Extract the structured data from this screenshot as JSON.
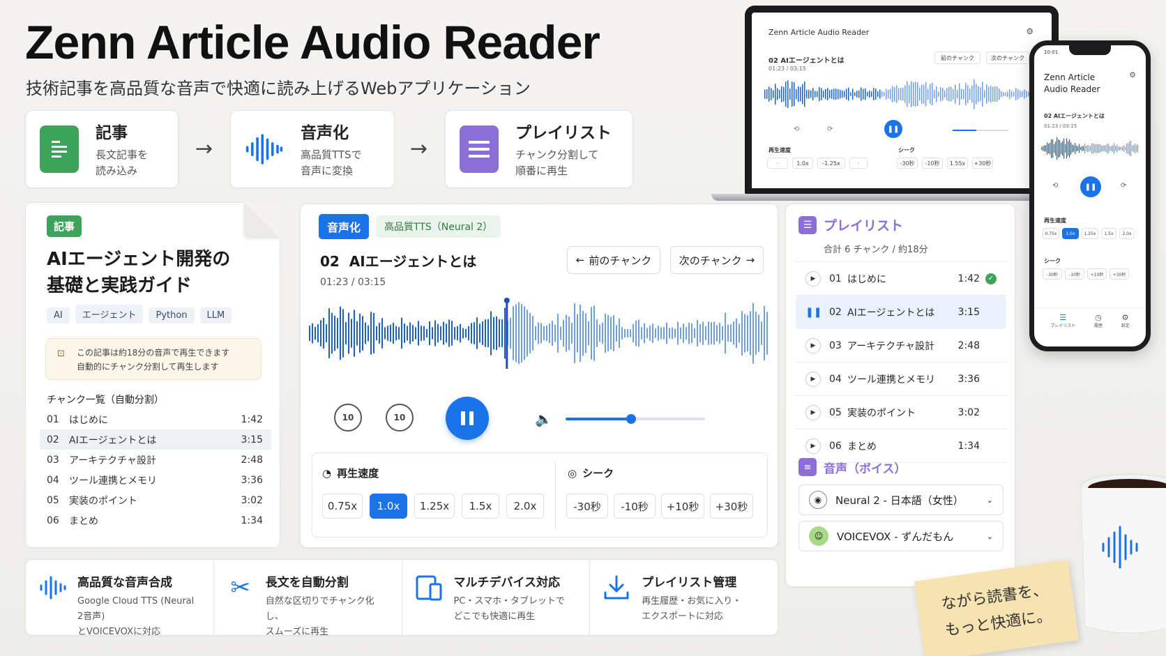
{
  "header": {
    "title": "Zenn Article Audio Reader",
    "subtitle": "技術記事を高品質な音声で快適に読み上げるWebアプリケーション"
  },
  "flow": [
    {
      "title": "記事",
      "desc1": "長文記事を",
      "desc2": "読み込み",
      "icon": "document-icon",
      "color": "#3da35a"
    },
    {
      "title": "音声化",
      "desc1": "高品質TTSで",
      "desc2": "音声に変換",
      "icon": "waveform-icon",
      "color": "#1a73e8"
    },
    {
      "title": "プレイリスト",
      "desc1": "チャンク分割して",
      "desc2": "順番に再生",
      "icon": "list-icon",
      "color": "#8b6fd6"
    }
  ],
  "article": {
    "badge": "記事",
    "title_line1": "AIエージェント開発の",
    "title_line2": "基礎と実践ガイド",
    "tags": [
      "AI",
      "エージェント",
      "Python",
      "LLM"
    ],
    "note_line1": "この記事は約18分の音声で再生できます",
    "note_line2": "自動的にチャンク分割して再生します",
    "chunk_heading": "チャンク一覧（自動分割）",
    "chunks": [
      {
        "no": "01",
        "title": "はじめに",
        "dur": "1:42"
      },
      {
        "no": "02",
        "title": "AIエージェントとは",
        "dur": "3:15"
      },
      {
        "no": "03",
        "title": "アーキテクチャ設計",
        "dur": "2:48"
      },
      {
        "no": "04",
        "title": "ツール連携とメモリ",
        "dur": "3:36"
      },
      {
        "no": "05",
        "title": "実装のポイント",
        "dur": "3:02"
      },
      {
        "no": "06",
        "title": "まとめ",
        "dur": "1:34"
      }
    ]
  },
  "player": {
    "badge": "音声化",
    "engine": "高品質TTS（Neural 2）",
    "track_no": "02",
    "track_title": "AIエージェントとは",
    "time": "01:23 / 03:15",
    "prev_label": "前のチャンク",
    "next_label": "次のチャンク",
    "progress": 0.43,
    "volume": 0.47,
    "back_label": "10",
    "fwd_label": "10",
    "speed_heading": "再生速度",
    "speeds": [
      "0.75x",
      "1.0x",
      "1.25x",
      "1.5x",
      "2.0x"
    ],
    "speed_selected": "1.0x",
    "seek_heading": "シーク",
    "seeks": [
      "-30秒",
      "-10秒",
      "+10秒",
      "+30秒"
    ]
  },
  "playlist": {
    "title": "プレイリスト",
    "summary": "合計 6 チャンク / 約18分",
    "items": [
      {
        "no": "01",
        "title": "はじめに",
        "dur": "1:42",
        "done": true
      },
      {
        "no": "02",
        "title": "AIエージェントとは",
        "dur": "3:15",
        "playing": true
      },
      {
        "no": "03",
        "title": "アーキテクチャ設計",
        "dur": "2:48"
      },
      {
        "no": "04",
        "title": "ツール連携とメモリ",
        "dur": "3:36"
      },
      {
        "no": "05",
        "title": "実装のポイント",
        "dur": "3:02"
      },
      {
        "no": "06",
        "title": "まとめ",
        "dur": "1:34"
      }
    ],
    "voice_heading": "音声（ボイス）",
    "voices": [
      "Neural 2 - 日本語（女性）",
      "VOICEVOX - ずんだもん"
    ]
  },
  "features": [
    {
      "title": "高品質な音声合成",
      "line1": "Google Cloud TTS (Neural 2音声)",
      "line2": "とVOICEVOXに対応",
      "icon": "waveform-icon"
    },
    {
      "title": "長文を自動分割",
      "line1": "自然な区切りでチャンク化し、",
      "line2": "スムーズに再生",
      "icon": "scissors-icon"
    },
    {
      "title": "マルチデバイス対応",
      "line1": "PC・スマホ・タブレットで",
      "line2": "どこでも快適に再生",
      "icon": "devices-icon"
    },
    {
      "title": "プレイリスト管理",
      "line1": "再生履歴・お気に入り・",
      "line2": "エクスポートに対応",
      "icon": "download-icon"
    }
  ],
  "laptop": {
    "app_title": "Zenn Article Audio Reader",
    "track": "02  AIエージェントとは",
    "time": "01:23 / 03:15",
    "prev": "前のチャンク",
    "next": "次のチャンク",
    "speed_heading": "再生速度",
    "speeds": [
      "1.0x",
      "-1.25x"
    ],
    "seek_heading": "シーク",
    "seeks": [
      "-30秒",
      "-10秒",
      "1.55x",
      "+30秒"
    ]
  },
  "phone": {
    "status_time": "10:01",
    "app_title_1": "Zenn Article",
    "app_title_2": "Audio Reader",
    "track": "02  AIエージェントとは",
    "time": "01:23 / 03:15",
    "speed_heading": "再生速度",
    "speeds": [
      "0.75x",
      "1.0x",
      "1.25x",
      "1.5x",
      "2.0x"
    ],
    "seek_heading": "シーク",
    "seeks": [
      "-30秒",
      "-10秒",
      "+10秒",
      "+30秒"
    ],
    "nav": [
      "プレイリスト",
      "履歴",
      "設定"
    ]
  },
  "sticky_note": {
    "line1": "ながら読書を、",
    "line2": "もっと快適に。"
  },
  "colors": {
    "accent": "#1a73e8",
    "green": "#3da35a",
    "purple": "#8b6fd6"
  }
}
